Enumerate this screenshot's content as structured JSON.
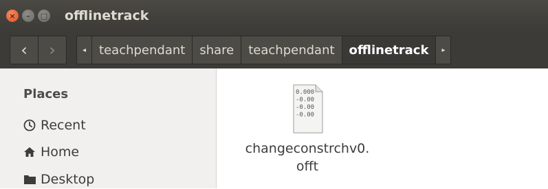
{
  "window": {
    "title": "offlinetrack",
    "buttons": [
      {
        "name": "close",
        "glyph": "×"
      },
      {
        "name": "minimize",
        "glyph": "–"
      },
      {
        "name": "maximize",
        "glyph": "□"
      }
    ]
  },
  "toolbar": {
    "back_glyph": "‹",
    "forward_glyph": "›",
    "path_left_glyph": "◂",
    "path_right_glyph": "▸",
    "breadcrumbs": [
      "teachpendant",
      "share",
      "teachpendant",
      "offlinetrack"
    ]
  },
  "sidebar": {
    "heading": "Places",
    "items": [
      {
        "label": "Recent",
        "icon": "clock-icon"
      },
      {
        "label": "Home",
        "icon": "home-icon"
      },
      {
        "label": "Desktop",
        "icon": "folder-icon"
      }
    ]
  },
  "files": [
    {
      "name_line1": "changeconstrchv0.",
      "name_line2": "offt",
      "preview_lines": [
        "0.000",
        "-0.00",
        "-0.00",
        "-0.00"
      ]
    }
  ],
  "colors": {
    "titlebar": "#3c3b37",
    "close_button": "#e0502a",
    "sidebar_bg": "#f1f0ee"
  }
}
